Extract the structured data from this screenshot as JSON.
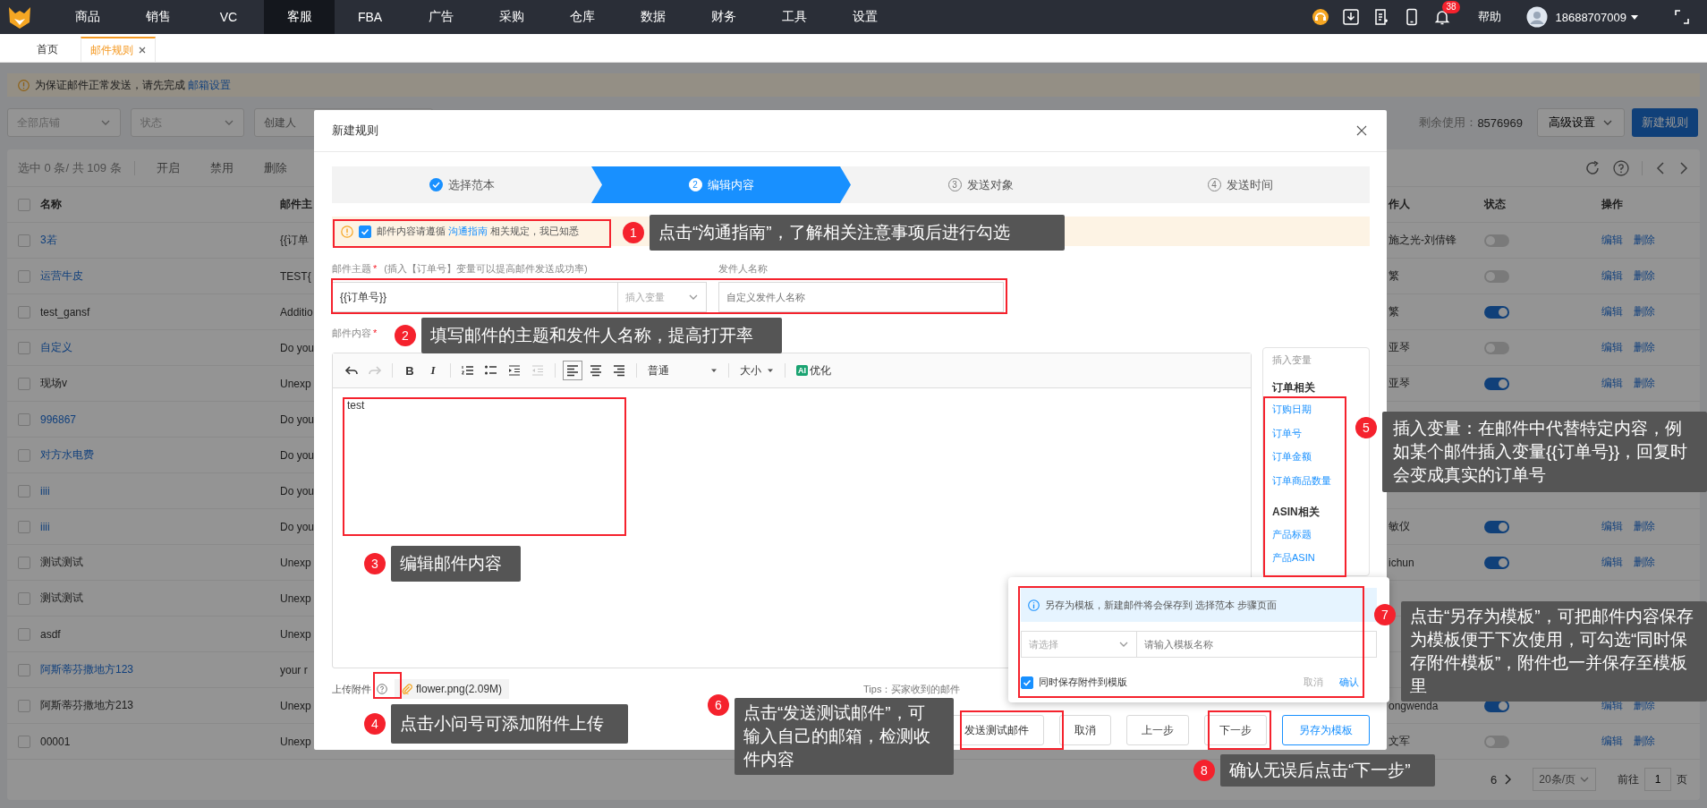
{
  "top_nav": {
    "menu": [
      {
        "label": "商品",
        "selected": false
      },
      {
        "label": "销售",
        "selected": false
      },
      {
        "label": "VC",
        "selected": false
      },
      {
        "label": "客服",
        "selected": true
      },
      {
        "label": "FBA",
        "selected": false
      },
      {
        "label": "广告",
        "selected": false
      },
      {
        "label": "采购",
        "selected": false
      },
      {
        "label": "仓库",
        "selected": false
      },
      {
        "label": "数据",
        "selected": false
      },
      {
        "label": "财务",
        "selected": false
      },
      {
        "label": "工具",
        "selected": false
      },
      {
        "label": "设置",
        "selected": false
      }
    ],
    "notification_count": "38",
    "help": "帮助",
    "user": "18688707009"
  },
  "page_tabs": [
    {
      "label": "首页",
      "selected": false
    },
    {
      "label": "邮件规则",
      "selected": true
    }
  ],
  "notice": {
    "text": "为保证邮件正常发送，请先完成 ",
    "link": "邮箱设置"
  },
  "filters": [
    {
      "kind": "select",
      "placeholder": "全部店铺"
    },
    {
      "kind": "select",
      "placeholder": "状态"
    },
    {
      "kind": "input",
      "placeholder": "创建人"
    }
  ],
  "quota": {
    "label": "剩余使用：",
    "value": "8576969"
  },
  "advanced_button": "高级设置",
  "new_button": "新建规则",
  "table": {
    "summary": "选中 0 条/ 共 109 条",
    "bulk_actions": [
      "开启",
      "禁用",
      "删除"
    ],
    "all_checked": false,
    "columns": [
      "名称",
      "邮件主",
      "作人",
      "状态",
      "操作"
    ],
    "rows": [
      {
        "checked": false,
        "name": "3若",
        "linked": true,
        "subject": "{{订单",
        "operator": "施之光-刘倩锋",
        "on": false,
        "actions": [
          "编辑",
          "删除"
        ]
      },
      {
        "checked": false,
        "name": "运营牛皮",
        "linked": true,
        "subject": "TEST{",
        "operator": "繁",
        "on": false,
        "actions": [
          "编辑",
          "删除"
        ]
      },
      {
        "checked": false,
        "name": "test_gansf",
        "linked": false,
        "subject": "Additio",
        "operator": "繁",
        "on": true,
        "actions": [
          "编辑",
          "删除"
        ]
      },
      {
        "checked": false,
        "name": "自定义",
        "linked": true,
        "subject": "Do you",
        "operator": "亚琴",
        "on": false,
        "actions": [
          "编辑",
          "删除"
        ]
      },
      {
        "checked": false,
        "name": "现场v",
        "linked": false,
        "subject": "Unexp",
        "operator": "亚琴",
        "on": true,
        "actions": [
          "编辑",
          "删除"
        ]
      },
      {
        "checked": false,
        "name": "996867",
        "linked": true,
        "subject": "Do you"
      },
      {
        "checked": false,
        "name": "对方水电费",
        "linked": true,
        "subject": "Do you"
      },
      {
        "checked": false,
        "name": "iiii",
        "linked": true,
        "subject": "Do you"
      },
      {
        "checked": false,
        "name": "iiii",
        "linked": true,
        "subject": "Do you",
        "operator": "敏仪",
        "on": true,
        "actions": [
          "编辑",
          "删除"
        ]
      },
      {
        "checked": false,
        "name": "测试测试",
        "linked": false,
        "subject": "Unexp",
        "operator": "ichun",
        "on": true,
        "actions": [
          "编辑",
          "删除"
        ]
      },
      {
        "checked": false,
        "name": "测试测试",
        "linked": false,
        "subject": "Unexp"
      },
      {
        "checked": false,
        "name": "asdf",
        "linked": false,
        "subject": "Unexp"
      },
      {
        "checked": false,
        "name": "阿斯蒂芬撒地方123",
        "linked": true,
        "subject": "your r"
      },
      {
        "checked": false,
        "name": "阿斯蒂芬撒地方213",
        "linked": false,
        "subject": "Unexp",
        "operator": "ongwenda",
        "on": true,
        "actions": [
          "编辑",
          "删除"
        ]
      },
      {
        "checked": false,
        "name": "00001",
        "linked": false,
        "subject": "Unexp",
        "operator": "文军",
        "on": false,
        "actions": [
          "编辑",
          "删除"
        ]
      }
    ]
  },
  "pagination": {
    "pages": [
      {
        "label": "6",
        "selected": false
      }
    ],
    "page_size": "20条/页",
    "goto_label": "前往",
    "goto_value": "1",
    "goto_suffix": "页"
  },
  "modal": {
    "title": "新建规则",
    "steps": [
      {
        "label": "选择范本",
        "done": true,
        "selected": false
      },
      {
        "number": "2",
        "label": "编辑内容",
        "done": false,
        "selected": true
      },
      {
        "number": "3",
        "label": "发送对象",
        "done": false,
        "selected": false
      },
      {
        "number": "4",
        "label": "发送时间",
        "done": false,
        "selected": false
      }
    ],
    "agreement": {
      "checked": true,
      "text_before": "邮件内容请遵循 ",
      "link": "沟通指南",
      "text_after": " 相关规定，我已知悉"
    },
    "subject": {
      "label": "邮件主题",
      "required_mark": "*",
      "hint": "(插入【订单号】变量可以提高邮件发送成功率)",
      "value": "{{订单号}}",
      "variable_placeholder": "插入变量"
    },
    "sender": {
      "label": "发件人名称",
      "placeholder": "自定义发件人名称"
    },
    "content": {
      "label": "邮件内容",
      "required_mark": "*",
      "body": "test"
    },
    "tools": [
      {
        "kind": "undo",
        "disabled": false
      },
      {
        "kind": "redo",
        "disabled": true
      },
      {
        "kind": "bold",
        "label": "B"
      },
      {
        "kind": "italic",
        "label": "I"
      },
      {
        "kind": "ordered-list",
        "disabled": false
      },
      {
        "kind": "bullet-list",
        "disabled": false
      },
      {
        "kind": "indent",
        "disabled": false
      },
      {
        "kind": "outdent",
        "disabled": true
      },
      {
        "kind": "align-left",
        "selected": true
      },
      {
        "kind": "align-center",
        "selected": false
      },
      {
        "kind": "align-right",
        "selected": false
      },
      {
        "kind": "dropdown",
        "label": "普通"
      },
      {
        "kind": "dropdown",
        "label": "大小"
      },
      {
        "kind": "ai",
        "badge": "AI",
        "label": "优化"
      }
    ],
    "variables": {
      "title": "插入变量",
      "groups": [
        {
          "title": "订单相关",
          "items": [
            "订购日期",
            "订单号",
            "订单金额",
            "订单商品数量"
          ]
        },
        {
          "title": "ASIN相关",
          "items": [
            "产品标题",
            "产品ASIN"
          ]
        }
      ]
    },
    "attachment": {
      "label": "上传附件",
      "file": "flower.png(2.09M)"
    },
    "tips": "Tips：买家收到的邮件",
    "buttons": [
      {
        "label": "发送测试邮件",
        "kind": "default"
      },
      {
        "label": "取消",
        "kind": "default"
      },
      {
        "label": "上一步",
        "kind": "default"
      },
      {
        "label": "下一步",
        "kind": "default"
      },
      {
        "label": "另存为模板",
        "kind": "primary"
      }
    ],
    "save_template": {
      "info": "另存为模板，新建邮件将会保存到 选择范本 步骤页面",
      "select_placeholder": "请选择",
      "name_placeholder": "请输入模板名称",
      "attach_checked": true,
      "attach_label": "同时保存附件到模版",
      "cancel": "取消",
      "confirm": "确认"
    }
  },
  "callouts": [
    {
      "number": "1",
      "text": "点击“沟通指南”，了解相关注意事项后进行勾选"
    },
    {
      "number": "2",
      "text": "填写邮件的主题和发件人名称，提高打开率"
    },
    {
      "number": "3",
      "text": "编辑邮件内容"
    },
    {
      "number": "4",
      "text": "点击小问号可添加附件上传"
    },
    {
      "number": "5",
      "text": "插入变量：在邮件中代替特定内容，例如某个邮件插入变量{{订单号}}，回复时会变成真实的订单号"
    },
    {
      "number": "6",
      "text": "点击“发送测试邮件”，可输入自己的邮箱，检测收件内容"
    },
    {
      "number": "7",
      "text": "点击“另存为模板”，可把邮件内容保存为模板便于下次使用，可勾选“同时保存附件模板”，附件也一并保存至模板里"
    },
    {
      "number": "8",
      "text": "确认无误后点击“下一步”"
    }
  ]
}
